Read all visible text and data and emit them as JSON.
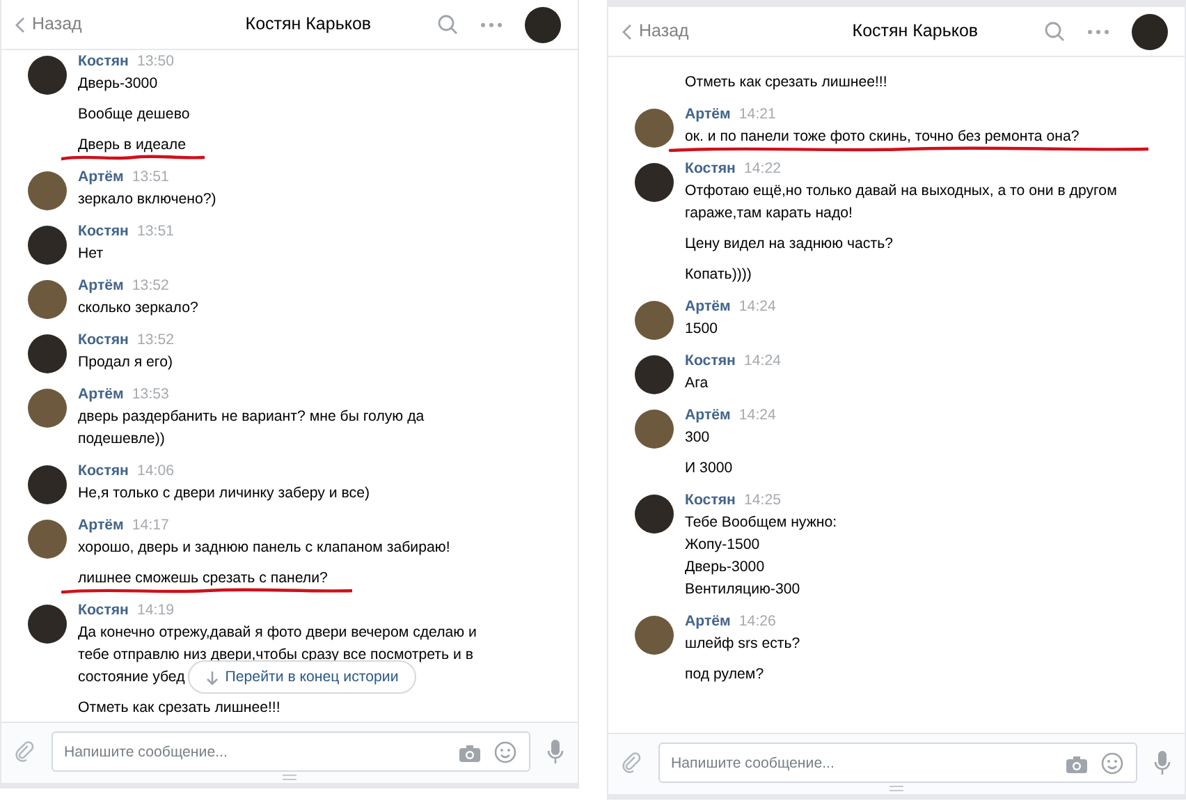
{
  "panels": [
    {
      "header": {
        "back": "Назад",
        "title": "Костян Карьков"
      },
      "messages": [
        {
          "author": "Костян",
          "time": "13:50",
          "color": "#2e2925",
          "paragraphs": [
            {
              "text": "Дверь-3000",
              "underlined": false
            },
            {
              "text": "Вообще дешево",
              "underlined": false
            },
            {
              "text": "Дверь в идеале",
              "underlined": true
            }
          ]
        },
        {
          "author": "Артём",
          "time": "13:51",
          "color": "#6d5a3e",
          "paragraphs": [
            {
              "text": "зеркало включено?)",
              "underlined": false
            }
          ]
        },
        {
          "author": "Костян",
          "time": "13:51",
          "color": "#2e2925",
          "paragraphs": [
            {
              "text": "Нет",
              "underlined": false
            }
          ]
        },
        {
          "author": "Артём",
          "time": "13:52",
          "color": "#6d5a3e",
          "paragraphs": [
            {
              "text": "сколько зеркало?",
              "underlined": false
            }
          ]
        },
        {
          "author": "Костян",
          "time": "13:52",
          "color": "#2e2925",
          "paragraphs": [
            {
              "text": "Продал я его)",
              "underlined": false
            }
          ]
        },
        {
          "author": "Артём",
          "time": "13:53",
          "color": "#6d5a3e",
          "paragraphs": [
            {
              "text": "дверь раздербанить не вариант? мне бы голую да\nподешевле))",
              "underlined": false
            }
          ]
        },
        {
          "author": "Костян",
          "time": "14:06",
          "color": "#2e2925",
          "paragraphs": [
            {
              "text": "Не,я только с двери личинку заберу и все)",
              "underlined": false
            }
          ]
        },
        {
          "author": "Артём",
          "time": "14:17",
          "color": "#6d5a3e",
          "paragraphs": [
            {
              "text": "хорошо, дверь и заднюю панель с клапаном забираю!",
              "underlined": false
            },
            {
              "text": "лишнее сможешь срезать с панели?",
              "underlined": true
            }
          ]
        },
        {
          "author": "Костян",
          "time": "14:19",
          "color": "#2e2925",
          "paragraphs": [
            {
              "text": "Да конечно отрежу,давай я фото двери вечером сделаю и\nтебе отправлю низ двери,чтобы сразу все посмотреть и в\nсостояние убед",
              "underlined": false
            },
            {
              "text": "Отметь как срезать лишнее!!!",
              "underlined": false
            }
          ]
        }
      ],
      "jump_button": "Перейти в конец истории",
      "composer": {
        "placeholder": "Напишите сообщение..."
      }
    },
    {
      "header": {
        "back": "Назад",
        "title": "Костян Карьков"
      },
      "messages": [
        {
          "paragraphs": [
            {
              "text": "Отметь как срезать лишнее!!!",
              "underlined": false
            }
          ]
        },
        {
          "author": "Артём",
          "time": "14:21",
          "color": "#6d5a3e",
          "paragraphs": [
            {
              "text": "ок. и по панели тоже фото скинь, точно без ремонта она?",
              "underlined": true
            }
          ]
        },
        {
          "author": "Костян",
          "time": "14:22",
          "color": "#2e2925",
          "paragraphs": [
            {
              "text": "Отфотаю ещё,но только давай на выходных, а то они в другом\nгараже,там карать надо!",
              "underlined": false
            },
            {
              "text": "Цену видел на заднюю часть?",
              "underlined": false
            },
            {
              "text": "Копать))))",
              "underlined": false
            }
          ]
        },
        {
          "author": "Артём",
          "time": "14:24",
          "color": "#6d5a3e",
          "paragraphs": [
            {
              "text": "1500",
              "underlined": false
            }
          ]
        },
        {
          "author": "Костян",
          "time": "14:24",
          "color": "#2e2925",
          "paragraphs": [
            {
              "text": "Ага",
              "underlined": false
            }
          ]
        },
        {
          "author": "Артём",
          "time": "14:24",
          "color": "#6d5a3e",
          "paragraphs": [
            {
              "text": "300",
              "underlined": false
            },
            {
              "text": "И 3000",
              "underlined": false
            }
          ]
        },
        {
          "author": "Костян",
          "time": "14:25",
          "color": "#2e2925",
          "paragraphs": [
            {
              "text": "Тебе Вообщем нужно:\nЖопу-1500\nДверь-3000\nВентиляцию-300",
              "underlined": false
            }
          ]
        },
        {
          "author": "Артём",
          "time": "14:26",
          "color": "#6d5a3e",
          "paragraphs": [
            {
              "text": "шлейф srs есть?",
              "underlined": false
            },
            {
              "text": "под рулем?",
              "underlined": false
            }
          ]
        }
      ],
      "composer": {
        "placeholder": "Напишите сообщение..."
      }
    }
  ]
}
